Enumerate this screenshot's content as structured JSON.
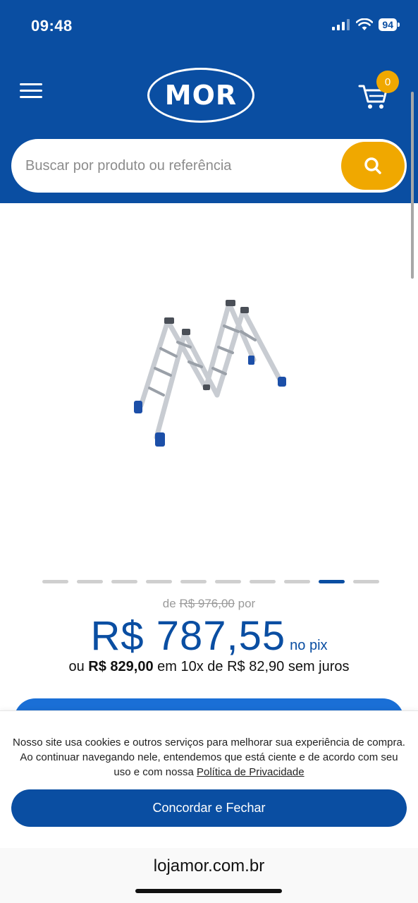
{
  "status_bar": {
    "time": "09:48",
    "battery": "94"
  },
  "header": {
    "logo_text": "MOR",
    "cart_count": "0"
  },
  "search": {
    "placeholder": "Buscar por produto ou referência"
  },
  "carousel": {
    "dot_count": 10,
    "active_index": 8
  },
  "pricing": {
    "old_prefix": "de",
    "old_price": "R$ 976,00",
    "old_suffix": "por",
    "price": "R$ 787,55",
    "price_suffix": "no pix",
    "installments_prefix": "ou",
    "installments_total": "R$ 829,00",
    "installments_rest": "em 10x de R$ 82,90 sem juros"
  },
  "cookie_banner": {
    "text": "Nosso site usa cookies e outros serviços para melhorar sua experiência de compra. Ao continuar navegando nele, entendemos que está ciente e de acordo com seu uso e com nossa",
    "link_label": "Política de Privacidade",
    "button_label": "Concordar e Fechar"
  },
  "browser": {
    "url": "lojamor.com.br"
  },
  "colors": {
    "brand_blue": "#0a4ea2",
    "accent_yellow": "#f0a800"
  }
}
